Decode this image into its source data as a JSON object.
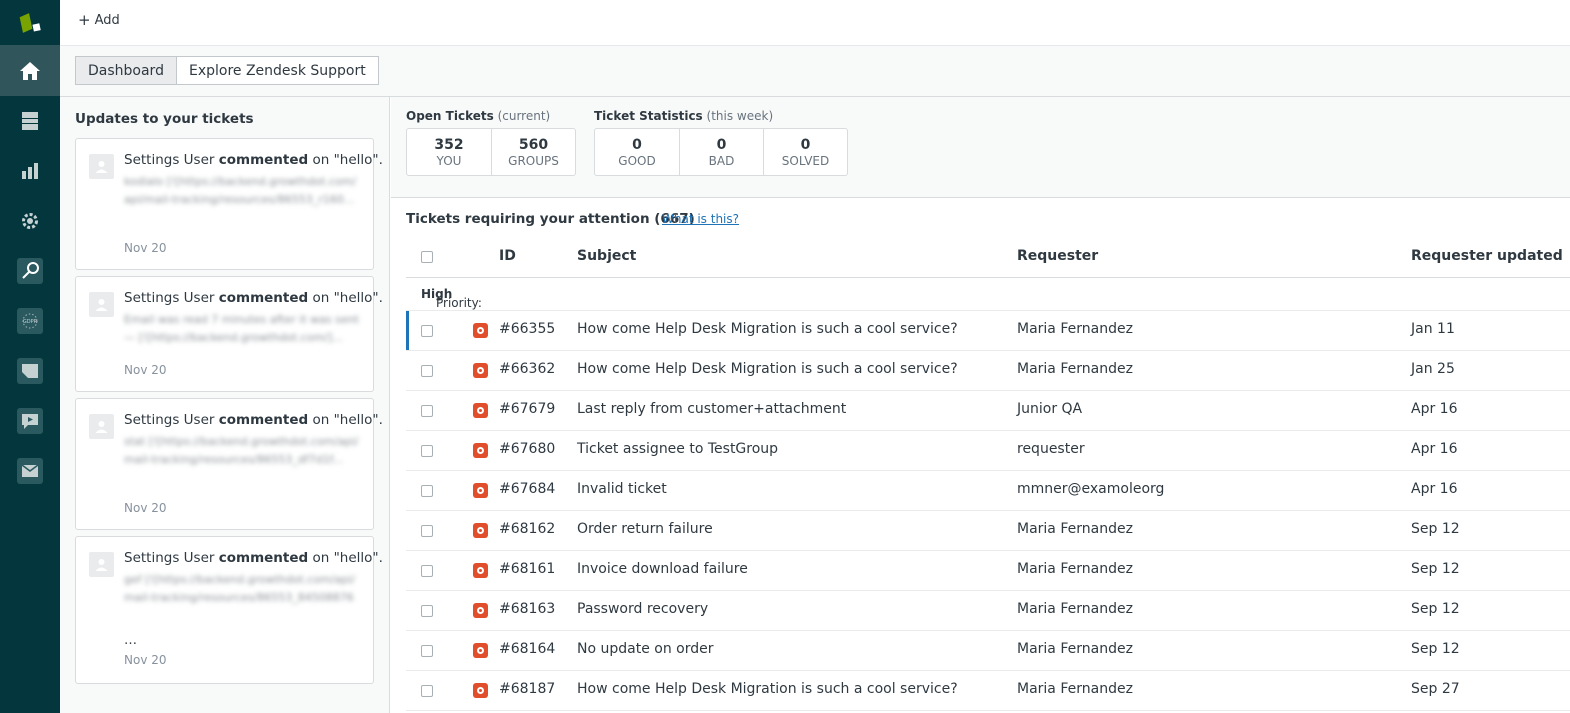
{
  "topbar": {
    "add_label": "Add"
  },
  "tabs": [
    {
      "label": "Dashboard"
    },
    {
      "label": "Explore Zendesk Support"
    }
  ],
  "updates": {
    "title": "Updates to your tickets",
    "items": [
      {
        "user": "Settings User",
        "action": "commented",
        "on_text": "on \"hello\".",
        "snippet": "kodialo [![https://backend.growthdot.com/api/mail-tracking/resources/86553_r160...",
        "date": "Nov 20",
        "ellipsis": ""
      },
      {
        "user": "Settings User",
        "action": "commented",
        "on_text": "on \"hello\".",
        "snippet": "Email was read 7 minutes after it was sent — [![https://backend.growthdot.com/]...",
        "date": "Nov 20",
        "ellipsis": ""
      },
      {
        "user": "Settings User",
        "action": "commented",
        "on_text": "on \"hello\".",
        "snippet": "stat [![https://backend.growthdot.com/api/mail-tracking/resources/86553_df7d1f...",
        "date": "Nov 20",
        "ellipsis": ""
      },
      {
        "user": "Settings User",
        "action": "commented",
        "on_text": "on \"hello\".",
        "snippet": "gef [![https://backend.growthdot.com/api/mail-tracking/resources/86553_84508876",
        "date": "Nov 20",
        "ellipsis": "…"
      }
    ]
  },
  "open_tickets": {
    "title": "Open Tickets",
    "subtitle": "(current)",
    "boxes": [
      {
        "value": "352",
        "label": "YOU"
      },
      {
        "value": "560",
        "label": "GROUPS"
      }
    ]
  },
  "ticket_stats": {
    "title": "Ticket Statistics",
    "subtitle": "(this week)",
    "boxes": [
      {
        "value": "0",
        "label": "GOOD"
      },
      {
        "value": "0",
        "label": "BAD"
      },
      {
        "value": "0",
        "label": "SOLVED"
      }
    ]
  },
  "attention": {
    "title": "Tickets requiring your attention (667)",
    "link": "What is this?"
  },
  "table": {
    "headers": {
      "id": "ID",
      "subject": "Subject",
      "requester": "Requester",
      "updated": "Requester updated"
    },
    "group_label": "Priority:",
    "group_value": "High",
    "rows": [
      {
        "id": "#66355",
        "subject": "How come Help Desk Migration is such a cool service?",
        "requester": "Maria Fernandez",
        "updated": "Jan 11"
      },
      {
        "id": "#66362",
        "subject": "How come Help Desk Migration is such a cool service?",
        "requester": "Maria Fernandez",
        "updated": "Jan 25"
      },
      {
        "id": "#67679",
        "subject": "Last reply from customer+attachment",
        "requester": "Junior QA",
        "updated": "Apr 16"
      },
      {
        "id": "#67680",
        "subject": "Ticket assignee to TestGroup",
        "requester": "requester",
        "updated": "Apr 16"
      },
      {
        "id": "#67684",
        "subject": "Invalid ticket",
        "requester": "mmner@examoleorg",
        "updated": "Apr 16"
      },
      {
        "id": "#68162",
        "subject": "Order return failure",
        "requester": "Maria Fernandez",
        "updated": "Sep 12"
      },
      {
        "id": "#68161",
        "subject": "Invoice download failure",
        "requester": "Maria Fernandez",
        "updated": "Sep 12"
      },
      {
        "id": "#68163",
        "subject": "Password recovery",
        "requester": "Maria Fernandez",
        "updated": "Sep 12"
      },
      {
        "id": "#68164",
        "subject": "No update on order",
        "requester": "Maria Fernandez",
        "updated": "Sep 12"
      },
      {
        "id": "#68187",
        "subject": "How come Help Desk Migration is such a cool service?",
        "requester": "Maria Fernandez",
        "updated": "Sep 27"
      }
    ]
  },
  "colors": {
    "nav_bg": "#03363d",
    "priority_high": "#e04e2c",
    "link": "#1f73b7",
    "logo": "#78a300"
  }
}
